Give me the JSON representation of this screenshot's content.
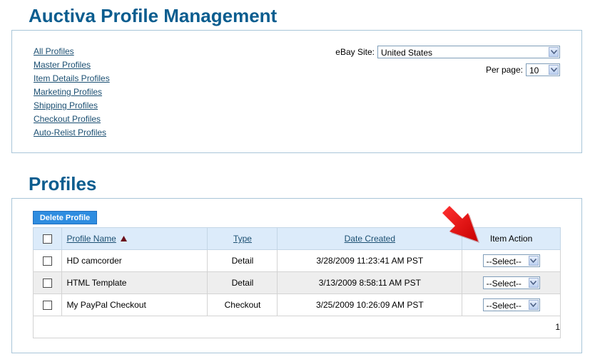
{
  "header": {
    "title": "Auctiva Profile Management"
  },
  "nav": {
    "links": [
      "All Profiles",
      "Master Profiles",
      "Item Details Profiles",
      "Marketing Profiles",
      "Shipping Profiles",
      "Checkout Profiles",
      "Auto-Relist Profiles"
    ]
  },
  "filters": {
    "site_label": "eBay Site:",
    "site_value": "United States",
    "perpage_label": "Per page:",
    "perpage_value": "10"
  },
  "profiles": {
    "title": "Profiles",
    "delete_label": "Delete Profile",
    "columns": {
      "name": "Profile Name",
      "type": "Type",
      "date": "Date Created",
      "action": "Item Action"
    },
    "sort_direction": "ascending",
    "rows": [
      {
        "name": "HD camcorder",
        "type": "Detail",
        "date": "3/28/2009 11:23:41 AM PST",
        "action": "--Select--"
      },
      {
        "name": "HTML Template",
        "type": "Detail",
        "date": "3/13/2009 8:58:11 AM PST",
        "action": "--Select--"
      },
      {
        "name": "My PayPal Checkout",
        "type": "Checkout",
        "date": "3/25/2009 10:26:09 AM PST",
        "action": "--Select--"
      }
    ],
    "page": "1"
  },
  "colors": {
    "heading": "#0b5d8f",
    "link": "#1b4f72",
    "header_row": "#dcebfa",
    "button": "#2f8de0",
    "arrow": "#e60000"
  },
  "icons": {
    "sort": "triangle-up-icon",
    "dropdown": "chevron-down-icon",
    "pointer": "red-arrow-icon"
  }
}
